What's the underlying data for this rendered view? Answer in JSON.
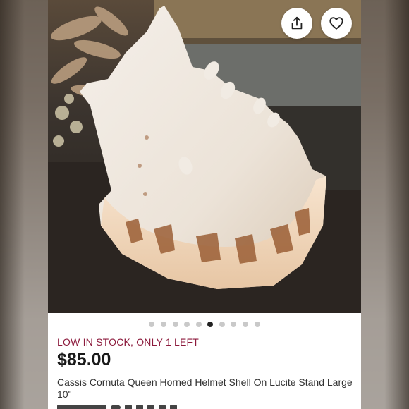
{
  "listing": {
    "stock_status": "LOW IN STOCK, ONLY 1 LEFT",
    "price": "$85.00",
    "title": "Cassis Cornuta Queen Horned Helmet Shell On Lucite Stand Large 10\""
  },
  "gallery": {
    "image_count": 10,
    "active_index": 5
  },
  "actions": {
    "share_icon": "share-icon",
    "favorite_icon": "heart-icon"
  },
  "colors": {
    "stock_status": "#8c1a3c",
    "dot_active": "#222222",
    "dot_inactive": "#c9c9c9"
  }
}
